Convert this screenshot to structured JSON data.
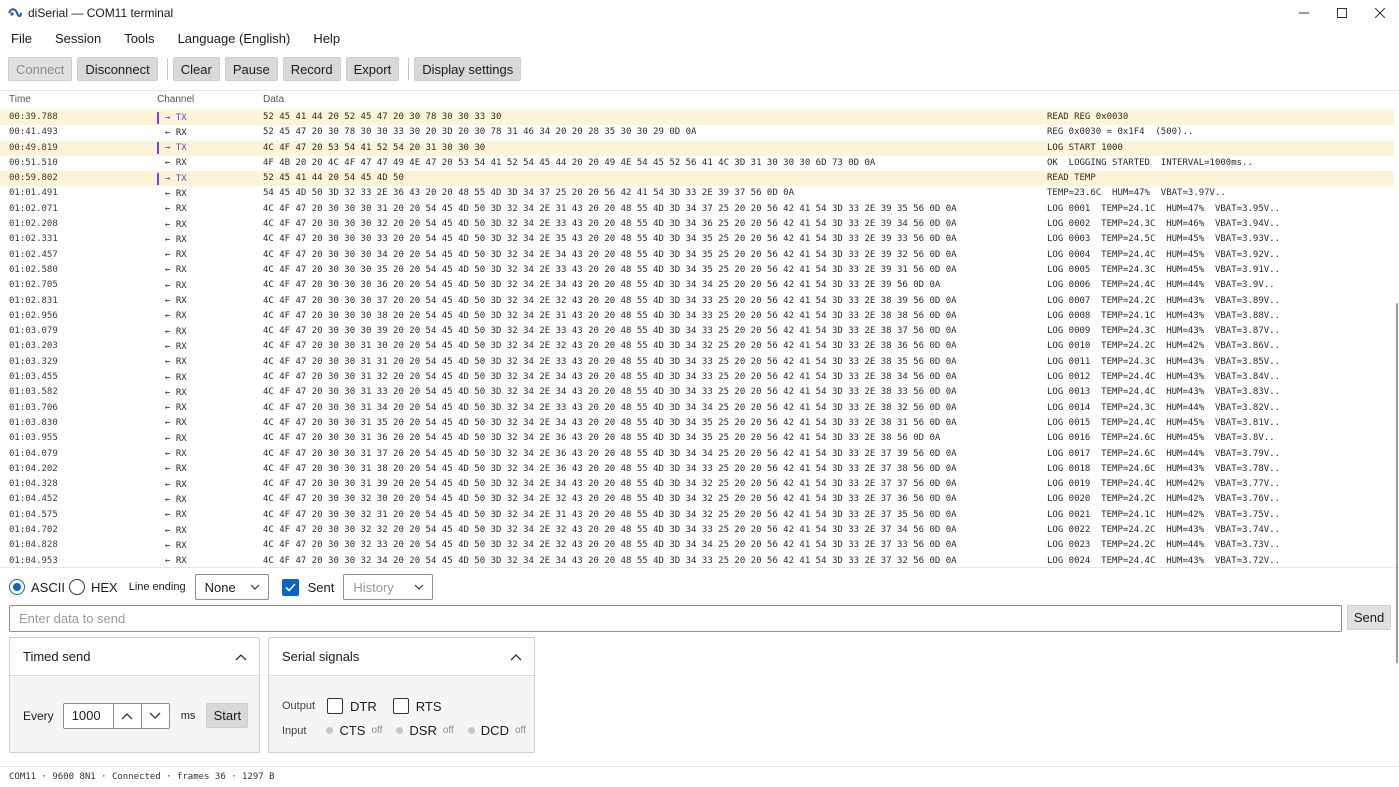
{
  "window": {
    "title": "diSerial — COM11 terminal"
  },
  "menu": [
    "File",
    "Session",
    "Tools",
    "Language (English)",
    "Help"
  ],
  "toolbar": {
    "connect": "Connect",
    "disconnect": "Disconnect",
    "clear": "Clear",
    "pause": "Pause",
    "record": "Record",
    "export": "Export",
    "display_settings": "Display settings"
  },
  "log": {
    "headers": {
      "time": "Time",
      "channel": "Channel",
      "data": "Data"
    },
    "rows": [
      {
        "dir": "tx",
        "time": "00:39.788",
        "channel": "→ TX",
        "hex": "52 45 41 44 20 52 45 47 20 30 78 30 30 33 30",
        "ascii": "READ REG 0x0030"
      },
      {
        "dir": "rx",
        "time": "00:41.493",
        "channel": "← RX",
        "hex": "52 45 47 20 30 78 30 30 33 30 20 3D 20 30 78 31 46 34 20 20 28 35 30 30 29 0D 0A",
        "ascii": "REG 0x0030 = 0x1F4  (500).."
      },
      {
        "dir": "tx",
        "time": "00:49.819",
        "channel": "→ TX",
        "hex": "4C 4F 47 20 53 54 41 52 54 20 31 30 30 30",
        "ascii": "LOG START 1000"
      },
      {
        "dir": "rx",
        "time": "00:51.510",
        "channel": "← RX",
        "hex": "4F 4B 20 20 4C 4F 47 47 49 4E 47 20 53 54 41 52 54 45 44 20 20 49 4E 54 45 52 56 41 4C 3D 31 30 30 30 6D 73 0D 0A",
        "ascii": "OK  LOGGING STARTED  INTERVAL=1000ms.."
      },
      {
        "dir": "tx",
        "time": "00:59.802",
        "channel": "→ TX",
        "hex": "52 45 41 44 20 54 45 4D 50",
        "ascii": "READ TEMP"
      },
      {
        "dir": "rx",
        "time": "01:01.491",
        "channel": "← RX",
        "hex": "54 45 4D 50 3D 32 33 2E 36 43 20 20 48 55 4D 3D 34 37 25 20 20 56 42 41 54 3D 33 2E 39 37 56 0D 0A",
        "ascii": "TEMP=23.6C  HUM=47%  VBAT=3.97V.."
      },
      {
        "dir": "rx",
        "time": "01:02.071",
        "channel": "← RX",
        "hex": "4C 4F 47 20 30 30 30 31 20 20 54 45 4D 50 3D 32 34 2E 31 43 20 20 48 55 4D 3D 34 37 25 20 20 56 42 41 54 3D 33 2E 39 35 56 0D 0A",
        "ascii": "LOG 0001  TEMP=24.1C  HUM=47%  VBAT=3.95V.."
      },
      {
        "dir": "rx",
        "time": "01:02.208",
        "channel": "← RX",
        "hex": "4C 4F 47 20 30 30 30 32 20 20 54 45 4D 50 3D 32 34 2E 33 43 20 20 48 55 4D 3D 34 36 25 20 20 56 42 41 54 3D 33 2E 39 34 56 0D 0A",
        "ascii": "LOG 0002  TEMP=24.3C  HUM=46%  VBAT=3.94V.."
      },
      {
        "dir": "rx",
        "time": "01:02.331",
        "channel": "← RX",
        "hex": "4C 4F 47 20 30 30 30 33 20 20 54 45 4D 50 3D 32 34 2E 35 43 20 20 48 55 4D 3D 34 35 25 20 20 56 42 41 54 3D 33 2E 39 33 56 0D 0A",
        "ascii": "LOG 0003  TEMP=24.5C  HUM=45%  VBAT=3.93V.."
      },
      {
        "dir": "rx",
        "time": "01:02.457",
        "channel": "← RX",
        "hex": "4C 4F 47 20 30 30 30 34 20 20 54 45 4D 50 3D 32 34 2E 34 43 20 20 48 55 4D 3D 34 35 25 20 20 56 42 41 54 3D 33 2E 39 32 56 0D 0A",
        "ascii": "LOG 0004  TEMP=24.4C  HUM=45%  VBAT=3.92V.."
      },
      {
        "dir": "rx",
        "time": "01:02.580",
        "channel": "← RX",
        "hex": "4C 4F 47 20 30 30 30 35 20 20 54 45 4D 50 3D 32 34 2E 33 43 20 20 48 55 4D 3D 34 35 25 20 20 56 42 41 54 3D 33 2E 39 31 56 0D 0A",
        "ascii": "LOG 0005  TEMP=24.3C  HUM=45%  VBAT=3.91V.."
      },
      {
        "dir": "rx",
        "time": "01:02.705",
        "channel": "← RX",
        "hex": "4C 4F 47 20 30 30 30 36 20 20 54 45 4D 50 3D 32 34 2E 34 43 20 20 48 55 4D 3D 34 34 25 20 20 56 42 41 54 3D 33 2E 39 56 0D 0A",
        "ascii": "LOG 0006  TEMP=24.4C  HUM=44%  VBAT=3.9V.."
      },
      {
        "dir": "rx",
        "time": "01:02.831",
        "channel": "← RX",
        "hex": "4C 4F 47 20 30 30 30 37 20 20 54 45 4D 50 3D 32 34 2E 32 43 20 20 48 55 4D 3D 34 33 25 20 20 56 42 41 54 3D 33 2E 38 39 56 0D 0A",
        "ascii": "LOG 0007  TEMP=24.2C  HUM=43%  VBAT=3.89V.."
      },
      {
        "dir": "rx",
        "time": "01:02.956",
        "channel": "← RX",
        "hex": "4C 4F 47 20 30 30 30 38 20 20 54 45 4D 50 3D 32 34 2E 31 43 20 20 48 55 4D 3D 34 33 25 20 20 56 42 41 54 3D 33 2E 38 38 56 0D 0A",
        "ascii": "LOG 0008  TEMP=24.1C  HUM=43%  VBAT=3.88V.."
      },
      {
        "dir": "rx",
        "time": "01:03.079",
        "channel": "← RX",
        "hex": "4C 4F 47 20 30 30 30 39 20 20 54 45 4D 50 3D 32 34 2E 33 43 20 20 48 55 4D 3D 34 33 25 20 20 56 42 41 54 3D 33 2E 38 37 56 0D 0A",
        "ascii": "LOG 0009  TEMP=24.3C  HUM=43%  VBAT=3.87V.."
      },
      {
        "dir": "rx",
        "time": "01:03.203",
        "channel": "← RX",
        "hex": "4C 4F 47 20 30 30 31 30 20 20 54 45 4D 50 3D 32 34 2E 32 43 20 20 48 55 4D 3D 34 32 25 20 20 56 42 41 54 3D 33 2E 38 36 56 0D 0A",
        "ascii": "LOG 0010  TEMP=24.2C  HUM=42%  VBAT=3.86V.."
      },
      {
        "dir": "rx",
        "time": "01:03.329",
        "channel": "← RX",
        "hex": "4C 4F 47 20 30 30 31 31 20 20 54 45 4D 50 3D 32 34 2E 33 43 20 20 48 55 4D 3D 34 33 25 20 20 56 42 41 54 3D 33 2E 38 35 56 0D 0A",
        "ascii": "LOG 0011  TEMP=24.3C  HUM=43%  VBAT=3.85V.."
      },
      {
        "dir": "rx",
        "time": "01:03.455",
        "channel": "← RX",
        "hex": "4C 4F 47 20 30 30 31 32 20 20 54 45 4D 50 3D 32 34 2E 34 43 20 20 48 55 4D 3D 34 33 25 20 20 56 42 41 54 3D 33 2E 38 34 56 0D 0A",
        "ascii": "LOG 0012  TEMP=24.4C  HUM=43%  VBAT=3.84V.."
      },
      {
        "dir": "rx",
        "time": "01:03.582",
        "channel": "← RX",
        "hex": "4C 4F 47 20 30 30 31 33 20 20 54 45 4D 50 3D 32 34 2E 34 43 20 20 48 55 4D 3D 34 33 25 20 20 56 42 41 54 3D 33 2E 38 33 56 0D 0A",
        "ascii": "LOG 0013  TEMP=24.4C  HUM=43%  VBAT=3.83V.."
      },
      {
        "dir": "rx",
        "time": "01:03.706",
        "channel": "← RX",
        "hex": "4C 4F 47 20 30 30 31 34 20 20 54 45 4D 50 3D 32 34 2E 33 43 20 20 48 55 4D 3D 34 34 25 20 20 56 42 41 54 3D 33 2E 38 32 56 0D 0A",
        "ascii": "LOG 0014  TEMP=24.3C  HUM=44%  VBAT=3.82V.."
      },
      {
        "dir": "rx",
        "time": "01:03.830",
        "channel": "← RX",
        "hex": "4C 4F 47 20 30 30 31 35 20 20 54 45 4D 50 3D 32 34 2E 34 43 20 20 48 55 4D 3D 34 35 25 20 20 56 42 41 54 3D 33 2E 38 31 56 0D 0A",
        "ascii": "LOG 0015  TEMP=24.4C  HUM=45%  VBAT=3.81V.."
      },
      {
        "dir": "rx",
        "time": "01:03.955",
        "channel": "← RX",
        "hex": "4C 4F 47 20 30 30 31 36 20 20 54 45 4D 50 3D 32 34 2E 36 43 20 20 48 55 4D 3D 34 35 25 20 20 56 42 41 54 3D 33 2E 38 56 0D 0A",
        "ascii": "LOG 0016  TEMP=24.6C  HUM=45%  VBAT=3.8V.."
      },
      {
        "dir": "rx",
        "time": "01:04.079",
        "channel": "← RX",
        "hex": "4C 4F 47 20 30 30 31 37 20 20 54 45 4D 50 3D 32 34 2E 36 43 20 20 48 55 4D 3D 34 34 25 20 20 56 42 41 54 3D 33 2E 37 39 56 0D 0A",
        "ascii": "LOG 0017  TEMP=24.6C  HUM=44%  VBAT=3.79V.."
      },
      {
        "dir": "rx",
        "time": "01:04.202",
        "channel": "← RX",
        "hex": "4C 4F 47 20 30 30 31 38 20 20 54 45 4D 50 3D 32 34 2E 36 43 20 20 48 55 4D 3D 34 33 25 20 20 56 42 41 54 3D 33 2E 37 38 56 0D 0A",
        "ascii": "LOG 0018  TEMP=24.6C  HUM=43%  VBAT=3.78V.."
      },
      {
        "dir": "rx",
        "time": "01:04.328",
        "channel": "← RX",
        "hex": "4C 4F 47 20 30 30 31 39 20 20 54 45 4D 50 3D 32 34 2E 34 43 20 20 48 55 4D 3D 34 32 25 20 20 56 42 41 54 3D 33 2E 37 37 56 0D 0A",
        "ascii": "LOG 0019  TEMP=24.4C  HUM=42%  VBAT=3.77V.."
      },
      {
        "dir": "rx",
        "time": "01:04.452",
        "channel": "← RX",
        "hex": "4C 4F 47 20 30 30 32 30 20 20 54 45 4D 50 3D 32 34 2E 32 43 20 20 48 55 4D 3D 34 32 25 20 20 56 42 41 54 3D 33 2E 37 36 56 0D 0A",
        "ascii": "LOG 0020  TEMP=24.2C  HUM=42%  VBAT=3.76V.."
      },
      {
        "dir": "rx",
        "time": "01:04.575",
        "channel": "← RX",
        "hex": "4C 4F 47 20 30 30 32 31 20 20 54 45 4D 50 3D 32 34 2E 31 43 20 20 48 55 4D 3D 34 32 25 20 20 56 42 41 54 3D 33 2E 37 35 56 0D 0A",
        "ascii": "LOG 0021  TEMP=24.1C  HUM=42%  VBAT=3.75V.."
      },
      {
        "dir": "rx",
        "time": "01:04.702",
        "channel": "← RX",
        "hex": "4C 4F 47 20 30 30 32 32 20 20 54 45 4D 50 3D 32 34 2E 32 43 20 20 48 55 4D 3D 34 33 25 20 20 56 42 41 54 3D 33 2E 37 34 56 0D 0A",
        "ascii": "LOG 0022  TEMP=24.2C  HUM=43%  VBAT=3.74V.."
      },
      {
        "dir": "rx",
        "time": "01:04.828",
        "channel": "← RX",
        "hex": "4C 4F 47 20 30 30 32 33 20 20 54 45 4D 50 3D 32 34 2E 32 43 20 20 48 55 4D 3D 34 34 25 20 20 56 42 41 54 3D 33 2E 37 33 56 0D 0A",
        "ascii": "LOG 0023  TEMP=24.2C  HUM=44%  VBAT=3.73V.."
      },
      {
        "dir": "rx",
        "time": "01:04.953",
        "channel": "← RX",
        "hex": "4C 4F 47 20 30 30 32 34 20 20 54 45 4D 50 3D 32 34 2E 34 43 20 20 48 55 4D 3D 34 33 25 20 20 56 42 41 54 3D 33 2E 37 32 56 0D 0A",
        "ascii": "LOG 0024  TEMP=24.4C  HUM=43%  VBAT=3.72V.."
      }
    ]
  },
  "send_options": {
    "ascii": "ASCII",
    "hex": "HEX",
    "mode_selected": "ascii",
    "line_ending_label": "Line ending",
    "line_ending_value": "None",
    "sent_label": "Sent",
    "sent_checked": true,
    "history_placeholder": "History"
  },
  "send": {
    "placeholder": "Enter data to send",
    "button": "Send"
  },
  "timed_send": {
    "title": "Timed send",
    "every_label": "Every",
    "interval_value": "1000",
    "unit": "ms",
    "start_button": "Start"
  },
  "serial_signals": {
    "title": "Serial signals",
    "output_label": "Output",
    "input_label": "Input",
    "outputs": [
      {
        "name": "DTR",
        "checked": false
      },
      {
        "name": "RTS",
        "checked": false
      }
    ],
    "inputs": [
      {
        "name": "CTS",
        "state": "off"
      },
      {
        "name": "DSR",
        "state": "off"
      },
      {
        "name": "DCD",
        "state": "off"
      }
    ]
  },
  "status": "COM11 · 9600 8N1 · Connected · frames 36 · 1297 B",
  "colors": {
    "accent": "#0a64c8",
    "tx_bar": "#7c3aed",
    "tx_row_bg": "#fdf3d6"
  }
}
